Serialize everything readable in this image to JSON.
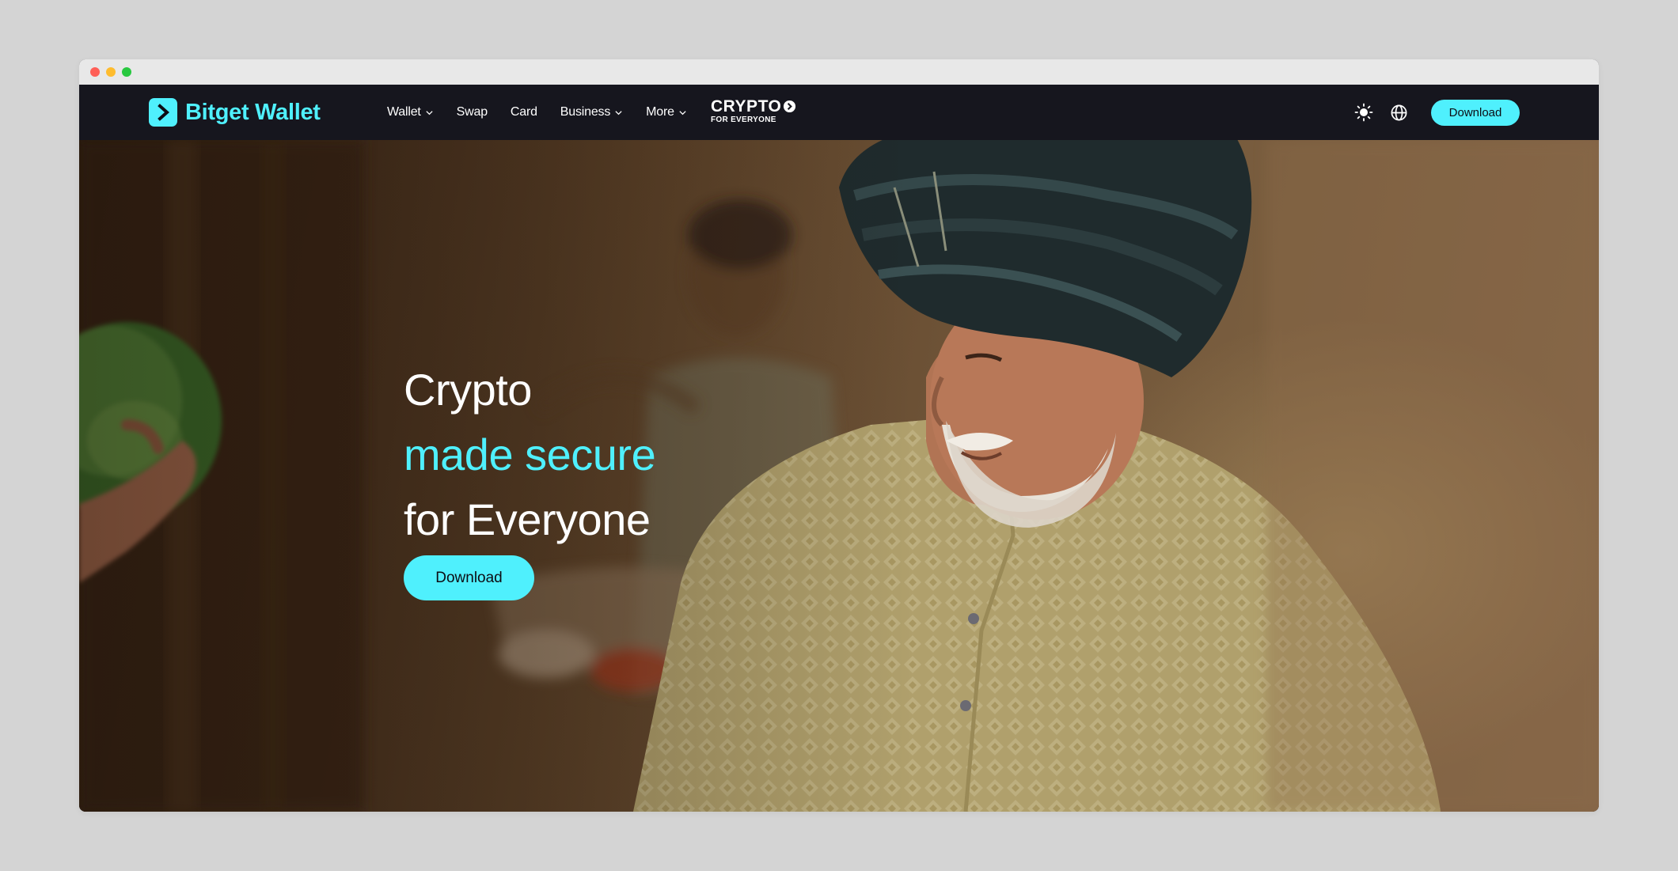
{
  "brand": {
    "name": "Bitget Wallet",
    "accent_color": "#4ff0fd",
    "nav_background": "#16161e"
  },
  "nav": {
    "items": [
      {
        "label": "Wallet",
        "has_dropdown": true
      },
      {
        "label": "Swap",
        "has_dropdown": false
      },
      {
        "label": "Card",
        "has_dropdown": false
      },
      {
        "label": "Business",
        "has_dropdown": true
      },
      {
        "label": "More",
        "has_dropdown": true
      }
    ],
    "campaign": {
      "line1": "CRYPTO",
      "line2": "FOR EVERYONE"
    },
    "theme_icon": "sun-icon",
    "language_icon": "globe-icon",
    "download_label": "Download"
  },
  "hero": {
    "line1": "Crypto",
    "line2": "made secure",
    "line3": "for Everyone",
    "download_label": "Download"
  }
}
